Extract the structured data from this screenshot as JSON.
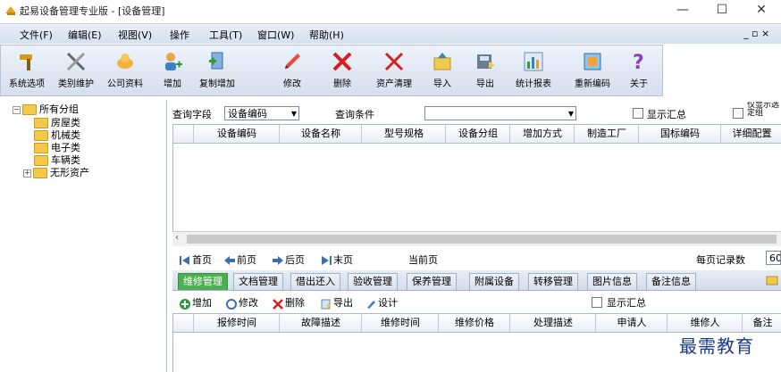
{
  "window": {
    "title": "起易设备管理专业版 - [设备管理]",
    "buttons": {
      "minimize": "—",
      "maximize": "☐",
      "close": "✕"
    }
  },
  "menubar": {
    "items": [
      "文件(F)",
      "编辑(E)",
      "视图(V)",
      "操作",
      "工具(T)",
      "窗口(W)",
      "帮助(H)"
    ],
    "right_controls": "_ ▫ ×"
  },
  "toolbar": {
    "items": [
      {
        "label": "系统选项",
        "icon": "hammer-icon"
      },
      {
        "label": "类别维护",
        "icon": "tools-icon"
      },
      {
        "label": "公司资料",
        "icon": "company-icon"
      },
      {
        "label": "增加",
        "icon": "add-user-icon"
      },
      {
        "label": "复制增加",
        "icon": "copy-add-icon"
      },
      {
        "label": "修改",
        "icon": "pencil-icon"
      },
      {
        "label": "删除",
        "icon": "delete-icon"
      },
      {
        "label": "资产清理",
        "icon": "clear-icon"
      },
      {
        "label": "导入",
        "icon": "import-icon"
      },
      {
        "label": "导出",
        "icon": "export-icon"
      },
      {
        "label": "统计报表",
        "icon": "chart-icon"
      },
      {
        "label": "重新编码",
        "icon": "recode-icon"
      },
      {
        "label": "关于",
        "icon": "help-icon"
      }
    ]
  },
  "tree": {
    "root": "所有分组",
    "children": [
      "房屋类",
      "机械类",
      "电子类",
      "车辆类",
      "无形资产"
    ]
  },
  "query": {
    "field_label": "查询字段",
    "field_value": "设备编码",
    "condition_label": "查询条件",
    "condition_value": "",
    "show_summary_label": "显示汇总",
    "show_selected_label": "仅显示选定组"
  },
  "main_grid": {
    "columns": [
      "设备编码",
      "设备名称",
      "型号规格",
      "设备分组",
      "增加方式",
      "制造工厂",
      "国标编码",
      "详细配置"
    ]
  },
  "pager": {
    "first": "首页",
    "prev": "前页",
    "next": "后页",
    "last": "末页",
    "current_page_label": "当前页",
    "records_per_page_label": "每页记录数",
    "records_per_page_value": "60"
  },
  "tabs": [
    "维修管理",
    "文档管理",
    "借出还入",
    "验收管理",
    "保养管理",
    "附属设备",
    "转移管理",
    "图片信息",
    "备注信息"
  ],
  "sub_toolbar": {
    "add": "增加",
    "edit": "修改",
    "delete": "删除",
    "export": "导出",
    "design": "设计",
    "show_summary_label": "显示汇总"
  },
  "detail_grid": {
    "columns": [
      "报修时间",
      "故障描述",
      "维修时间",
      "维修价格",
      "处理描述",
      "申请人",
      "维修人",
      "备注"
    ]
  },
  "watermark": "最需教育"
}
